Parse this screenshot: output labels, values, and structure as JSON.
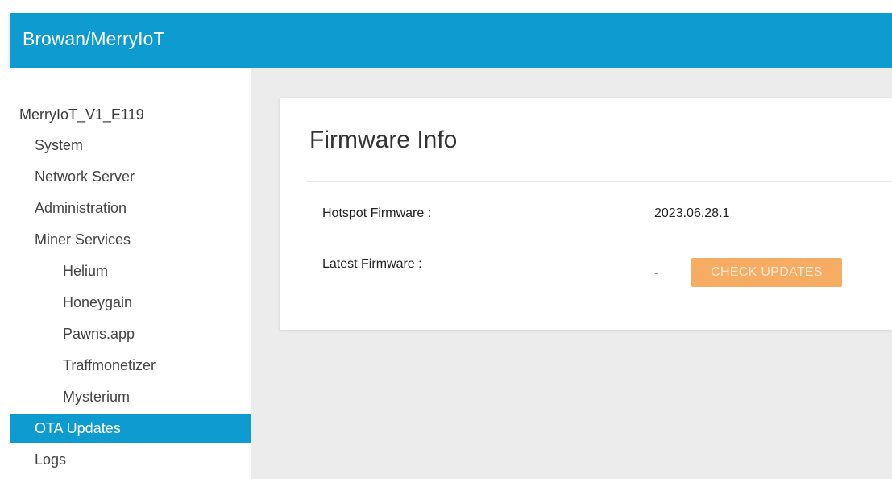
{
  "app": {
    "title": "Browan/MerryIoT"
  },
  "sidebar": {
    "device_name": "MerryIoT_V1_E119",
    "items": [
      {
        "label": "System"
      },
      {
        "label": "Network Server"
      },
      {
        "label": "Administration"
      },
      {
        "label": "Miner Services"
      },
      {
        "label": "Helium"
      },
      {
        "label": "Honeygain"
      },
      {
        "label": "Pawns.app"
      },
      {
        "label": "Traffmonetizer"
      },
      {
        "label": "Mysterium"
      },
      {
        "label": "OTA Updates"
      },
      {
        "label": "Logs"
      }
    ],
    "active_item": "OTA Updates"
  },
  "firmware_card": {
    "title": "Firmware Info",
    "hotspot_firmware_label": "Hotspot Firmware :",
    "hotspot_firmware_value": "2023.06.28.1",
    "latest_firmware_label": "Latest Firmware :",
    "latest_firmware_value": "-",
    "check_updates_label": "CHECK UPDATES"
  },
  "colors": {
    "accent": "#0d9bd0",
    "button": "#f6ad63",
    "content_bg": "#ececec"
  }
}
